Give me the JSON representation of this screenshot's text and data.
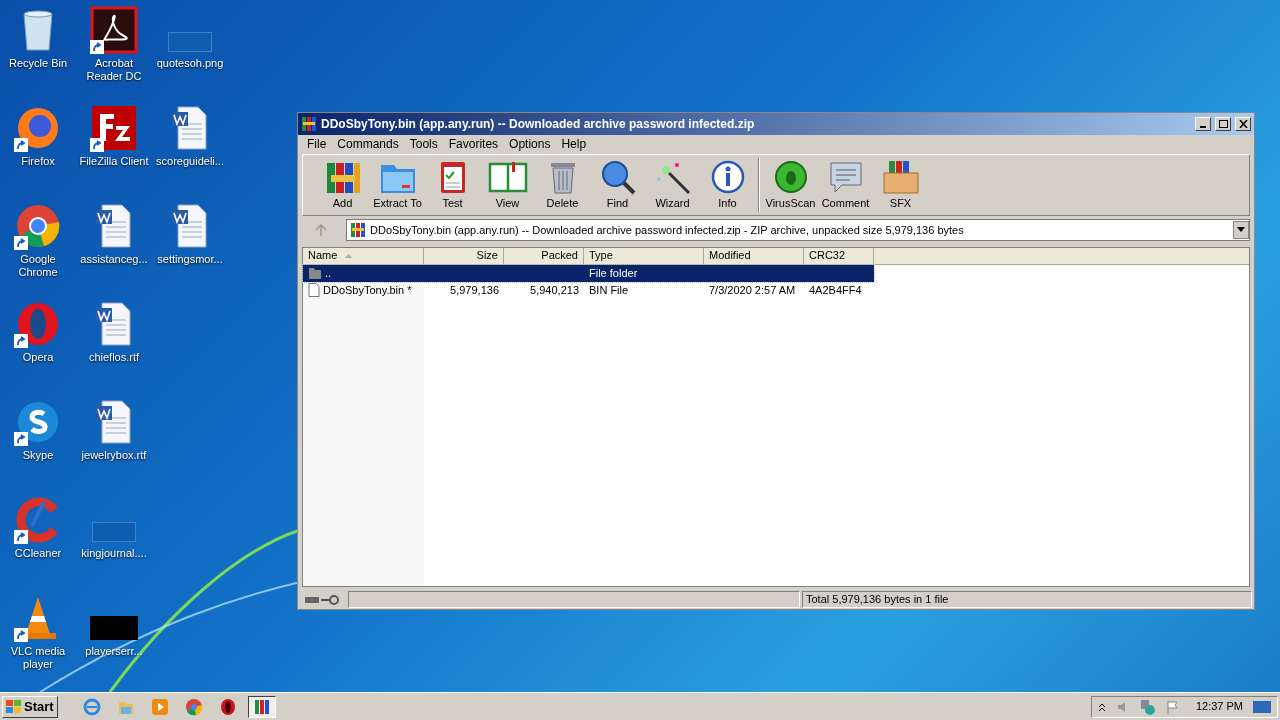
{
  "desktop_icons": [
    {
      "label": "Recycle Bin",
      "kind": "recycle",
      "shortcut": false
    },
    {
      "label": "Firefox",
      "kind": "firefox",
      "shortcut": true
    },
    {
      "label": "Google Chrome",
      "kind": "chrome",
      "shortcut": true
    },
    {
      "label": "Opera",
      "kind": "opera",
      "shortcut": true
    },
    {
      "label": "Skype",
      "kind": "skype",
      "shortcut": true
    },
    {
      "label": "CCleaner",
      "kind": "ccleaner",
      "shortcut": true
    },
    {
      "label": "VLC media player",
      "kind": "vlc",
      "shortcut": true
    },
    {
      "label": "Acrobat Reader DC",
      "kind": "acrobat",
      "shortcut": true
    },
    {
      "label": "FileZilla Client",
      "kind": "filezilla",
      "shortcut": true
    },
    {
      "label": "assistanceg...",
      "kind": "word",
      "shortcut": false
    },
    {
      "label": "chieflos.rtf",
      "kind": "word",
      "shortcut": false
    },
    {
      "label": "jewelrybox.rtf",
      "kind": "word",
      "shortcut": false
    },
    {
      "label": "kingjournal....",
      "kind": "blank",
      "shortcut": false
    },
    {
      "label": "playerserr...",
      "kind": "dark",
      "shortcut": false
    },
    {
      "label": "quotesoh.png",
      "kind": "blank",
      "shortcut": false
    },
    {
      "label": "scoreguideli...",
      "kind": "word",
      "shortcut": false
    },
    {
      "label": "settingsmor...",
      "kind": "word",
      "shortcut": false
    }
  ],
  "window": {
    "title": "DDoSbyTony.bin (app.any.run) -- Downloaded archive password infected.zip",
    "menu": [
      "File",
      "Commands",
      "Tools",
      "Favorites",
      "Options",
      "Help"
    ],
    "toolbar": [
      {
        "label": "Add",
        "kind": "add"
      },
      {
        "label": "Extract To",
        "kind": "extract"
      },
      {
        "label": "Test",
        "kind": "test"
      },
      {
        "label": "View",
        "kind": "view"
      },
      {
        "label": "Delete",
        "kind": "delete"
      },
      {
        "label": "Find",
        "kind": "find"
      },
      {
        "label": "Wizard",
        "kind": "wizard"
      },
      {
        "label": "Info",
        "kind": "info"
      },
      {
        "label": "VirusScan",
        "kind": "virus"
      },
      {
        "label": "Comment",
        "kind": "comment"
      },
      {
        "label": "SFX",
        "kind": "sfx"
      }
    ],
    "address": "DDoSbyTony.bin (app.any.run) -- Downloaded archive password infected.zip - ZIP archive, unpacked size 5,979,136 bytes",
    "columns": [
      "Name",
      "Size",
      "Packed",
      "Type",
      "Modified",
      "CRC32"
    ],
    "rows": [
      {
        "kind": "folder",
        "selected": true,
        "cells": [
          "..",
          "",
          "",
          "File folder",
          "",
          ""
        ]
      },
      {
        "kind": "file",
        "selected": false,
        "cells": [
          "DDoSbyTony.bin *",
          "5,979,136",
          "5,940,213",
          "BIN File",
          "7/3/2020 2:57 AM",
          "4A2B4FF4"
        ]
      }
    ],
    "status": "Total 5,979,136 bytes in 1 file"
  },
  "taskbar": {
    "start": "Start",
    "apps": [
      {
        "kind": "ie",
        "selected": false
      },
      {
        "kind": "explorer",
        "selected": false
      },
      {
        "kind": "media",
        "selected": false
      },
      {
        "kind": "chrome",
        "selected": false
      },
      {
        "kind": "opera",
        "selected": false
      },
      {
        "kind": "winrar",
        "selected": true
      }
    ],
    "clock": "12:37 PM"
  }
}
